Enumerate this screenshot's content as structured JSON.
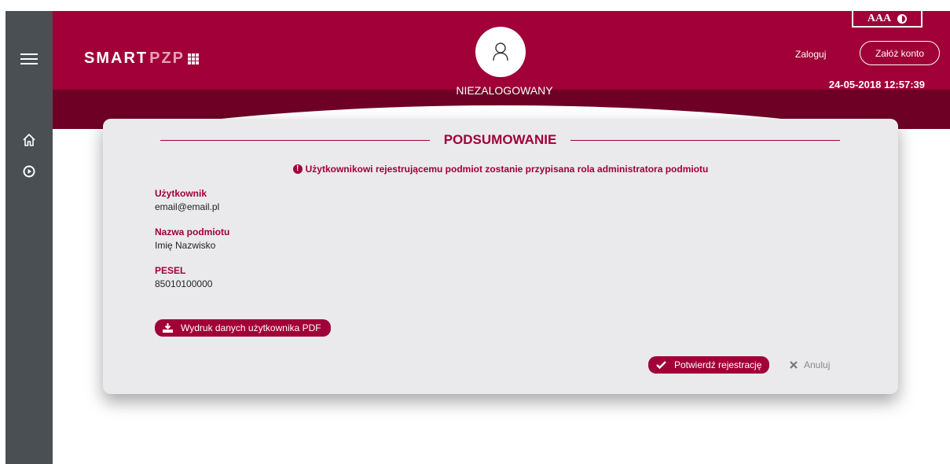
{
  "header": {
    "logo_main": "SMART",
    "logo_accent": "PZP",
    "user_status": "NIEZALOGOWANY",
    "font_size_label": "AAA",
    "login_label": "Zaloguj",
    "register_label": "Załóż konto",
    "datetime": "24-05-2018 12:57:39"
  },
  "sidebar": {
    "items": [
      {
        "icon": "menu-icon"
      },
      {
        "icon": "home-icon"
      },
      {
        "icon": "play-circle-icon"
      }
    ]
  },
  "summary": {
    "title": "PODSUMOWANIE",
    "warning": "Użytkownikowi rejestrującemu podmiot zostanie przypisana rola administratora podmiotu",
    "fields": [
      {
        "label": "Użytkownik",
        "value": "email@email.pl"
      },
      {
        "label": "Nazwa podmiotu",
        "value": "Imię Nazwisko"
      },
      {
        "label": "PESEL",
        "value": "85010100000"
      }
    ],
    "pdf_button": "Wydruk danych użytkownika PDF",
    "confirm_button": "Potwierdź rejestrację",
    "cancel_button": "Anuluj"
  },
  "colors": {
    "brand": "#a00037",
    "sidebar": "#4a4f54",
    "card": "#eaeaed"
  }
}
